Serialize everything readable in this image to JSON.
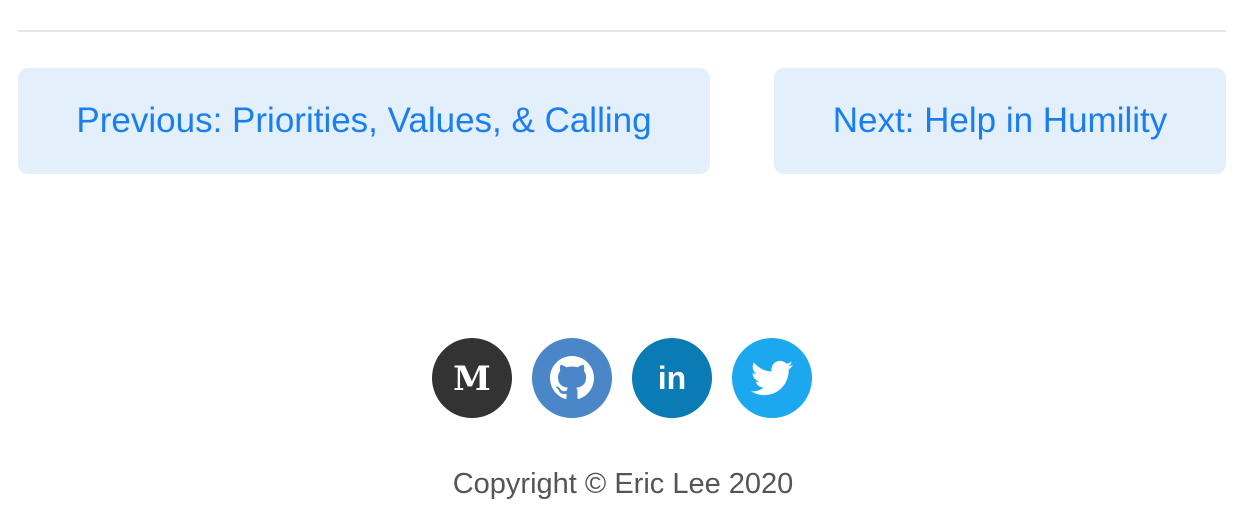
{
  "pagination": {
    "previous_label": "Previous: Priorities, Values, & Calling",
    "next_label": "Next: Help in Humility"
  },
  "social": [
    {
      "name": "medium",
      "icon": "medium-icon",
      "glyph": "M",
      "color": "#333333"
    },
    {
      "name": "github",
      "icon": "github-icon",
      "color": "#4a86c8"
    },
    {
      "name": "linkedin",
      "icon": "linkedin-icon",
      "glyph": "in",
      "color": "#0a7bb4"
    },
    {
      "name": "twitter",
      "icon": "twitter-icon",
      "color": "#1ca8ee"
    }
  ],
  "footer": {
    "copyright": "Copyright © Eric Lee 2020"
  },
  "colors": {
    "link": "#1a7ef0",
    "button_bg": "#e3f0fc",
    "text_muted": "#555555"
  }
}
